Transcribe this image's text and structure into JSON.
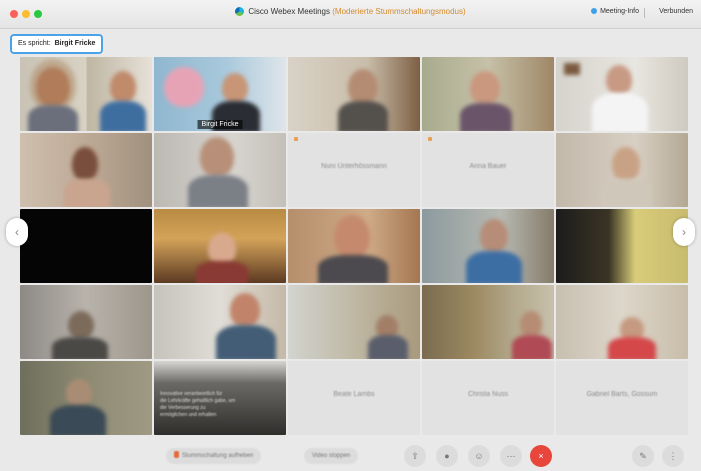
{
  "window": {
    "title": "Cisco Webex Meetings",
    "subtitle": "(Moderierte Stummschaltungsmodus)",
    "meeting_info": "Meeting-Info",
    "connection_status": "Verbunden"
  },
  "speaker": {
    "label": "Es spricht:",
    "name": "Birgit Fricke"
  },
  "tiles": [
    {
      "id": "r1c1",
      "caption": ""
    },
    {
      "id": "r1c2",
      "caption": "Birgit Fricke",
      "active": true
    },
    {
      "id": "r1c3",
      "caption": ""
    },
    {
      "id": "r1c4",
      "caption": ""
    },
    {
      "id": "r1c5",
      "caption": ""
    },
    {
      "id": "r2c3",
      "name": "Nuni Unterhössmann"
    },
    {
      "id": "r2c4",
      "name": "Anna Bauer"
    },
    {
      "id": "r5c3",
      "name": "Beate Lambs"
    },
    {
      "id": "r5c4",
      "name": "Christa Nuss"
    },
    {
      "id": "r5c5",
      "name": "Gabriel Barts, Gossum"
    }
  ],
  "chat_overlay": {
    "lines": [
      "Innovative verantwortlich für",
      "die Lehrkräfte gehaltlich gabe, um",
      "die Verbesserung zu",
      "ermöglichen und erhalten"
    ]
  },
  "toolbar": {
    "mute_label": "Stummschaltung aufheben",
    "video_label": "Video stoppen",
    "end_icon": "×"
  },
  "nav": {
    "left": "‹",
    "right": "›"
  },
  "colors": {
    "accent": "#2f8fe8",
    "end_call": "#e8453c",
    "subtitle": "#d68a2b"
  }
}
